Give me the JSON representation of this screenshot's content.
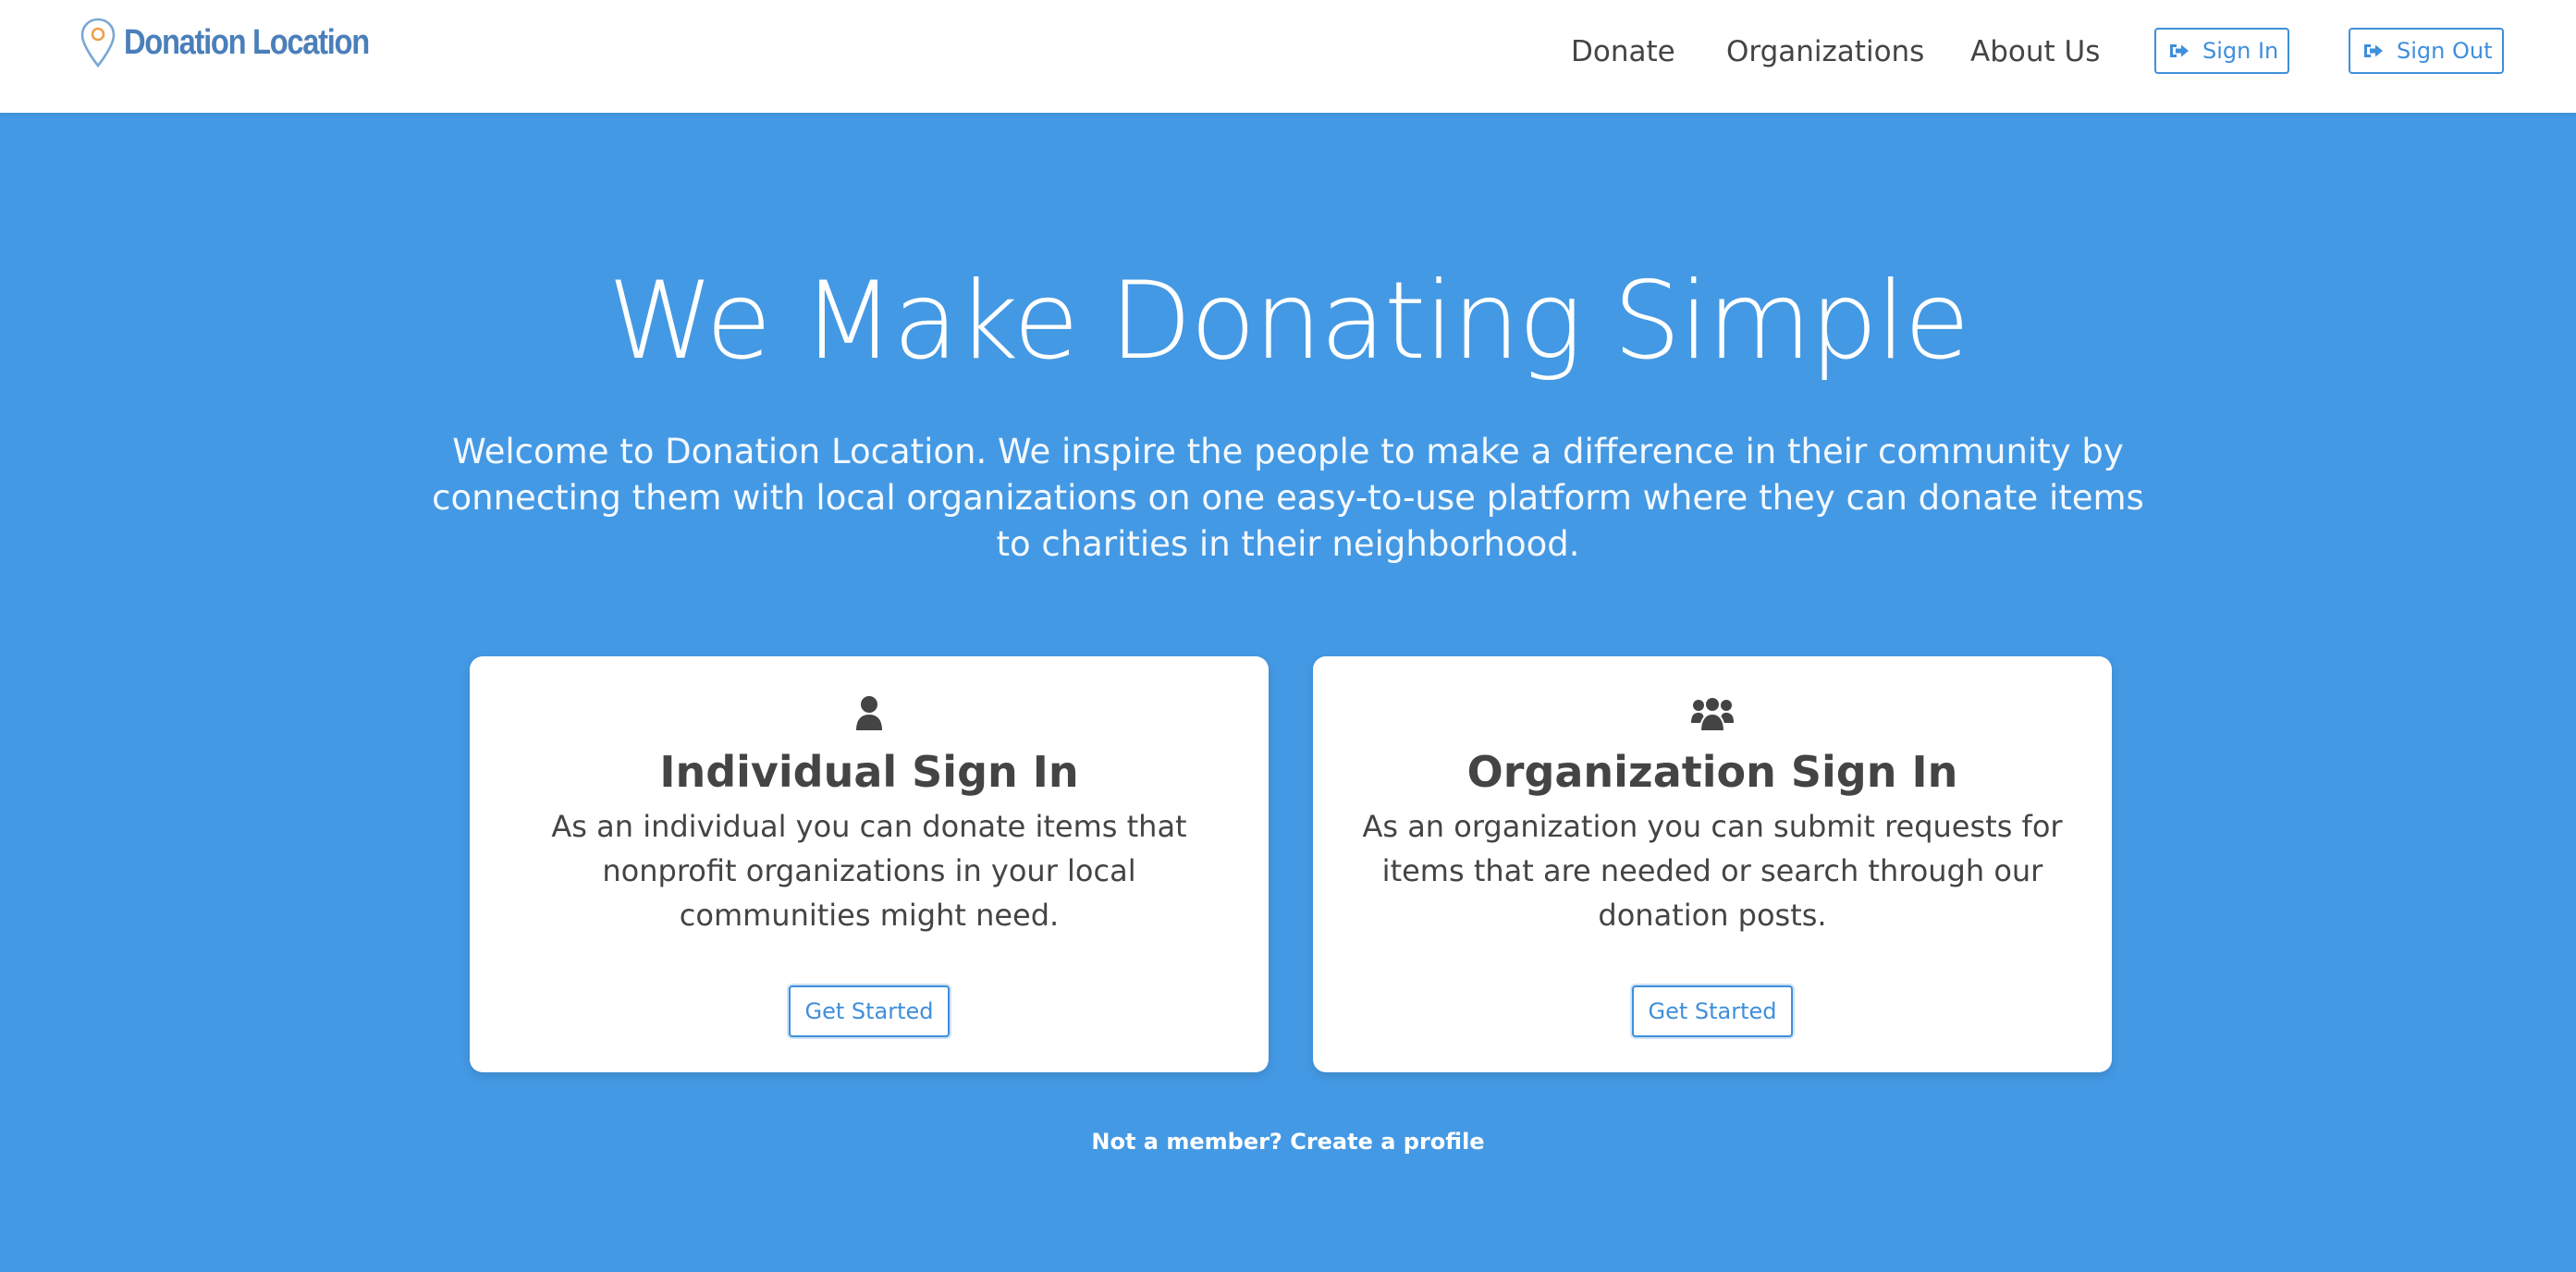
{
  "colors": {
    "hero_background": "#4499e4",
    "navbar_background": "#ffffff",
    "accent": "#3f8fdb",
    "brand": "#4a7fb9",
    "text_dark": "#444444",
    "pin_dot": "#f0a04b"
  },
  "brand": {
    "name": "Donation Location",
    "icon": "map-pin-icon"
  },
  "nav": {
    "links": [
      "Donate",
      "Organizations",
      "About Us"
    ],
    "sign_in_label": "Sign In",
    "sign_out_label": "Sign Out",
    "button_icon": "sign-in-arrow-icon"
  },
  "hero": {
    "title": "We Make Donating Simple",
    "subtitle": "Welcome to Donation Location. We inspire the people to make a difference in their community by connecting them with local organizations on one easy-to-use platform where they can donate items to charities in their neighborhood."
  },
  "cards": [
    {
      "icon": "user-icon",
      "title": "Individual Sign In",
      "description": "As an individual you can donate items that nonprofit organizations in your local communities might need.",
      "button_label": "Get Started"
    },
    {
      "icon": "users-group-icon",
      "title": "Organization Sign In",
      "description": "As an organization you can submit requests for items that are needed or search through our donation posts.",
      "button_label": "Get Started"
    }
  ],
  "footer": {
    "create_profile_text": "Not a member? Create a profile"
  }
}
